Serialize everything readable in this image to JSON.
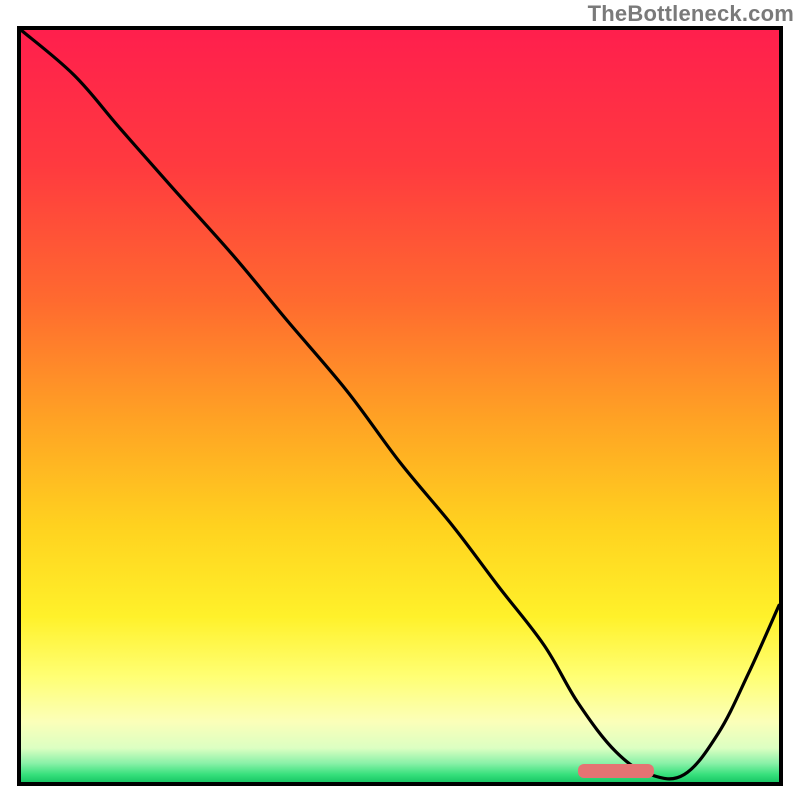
{
  "attribution": {
    "text": "TheBottleneck.com"
  },
  "colors": {
    "frame": "#000000",
    "curve": "#000000",
    "marker": "#e57373",
    "gradient_stops": [
      {
        "pos": 0.0,
        "color": "#ff1f4d"
      },
      {
        "pos": 0.18,
        "color": "#ff3a3f"
      },
      {
        "pos": 0.36,
        "color": "#ff6a2f"
      },
      {
        "pos": 0.52,
        "color": "#ffa324"
      },
      {
        "pos": 0.66,
        "color": "#ffd21f"
      },
      {
        "pos": 0.78,
        "color": "#fff12a"
      },
      {
        "pos": 0.86,
        "color": "#ffff74"
      },
      {
        "pos": 0.92,
        "color": "#fbffb9"
      },
      {
        "pos": 0.955,
        "color": "#dcffc2"
      },
      {
        "pos": 0.975,
        "color": "#8af1a8"
      },
      {
        "pos": 0.99,
        "color": "#37e07c"
      },
      {
        "pos": 1.0,
        "color": "#19c765"
      }
    ]
  },
  "chart_data": {
    "type": "line",
    "title": "",
    "xlabel": "",
    "ylabel": "",
    "x": [
      0.0,
      0.07,
      0.13,
      0.2,
      0.28,
      0.35,
      0.43,
      0.5,
      0.57,
      0.63,
      0.69,
      0.735,
      0.785,
      0.83,
      0.875,
      0.92,
      0.96,
      1.0
    ],
    "series": [
      {
        "name": "bottleneck-curve",
        "values": [
          1.0,
          0.94,
          0.87,
          0.79,
          0.7,
          0.615,
          0.52,
          0.425,
          0.34,
          0.26,
          0.182,
          0.105,
          0.04,
          0.01,
          0.01,
          0.065,
          0.145,
          0.235
        ]
      }
    ],
    "marker": {
      "x0": 0.735,
      "x1": 0.835,
      "y": 0.006,
      "height_frac": 0.018
    },
    "xlim": [
      0,
      1
    ],
    "ylim": [
      0,
      1
    ]
  }
}
